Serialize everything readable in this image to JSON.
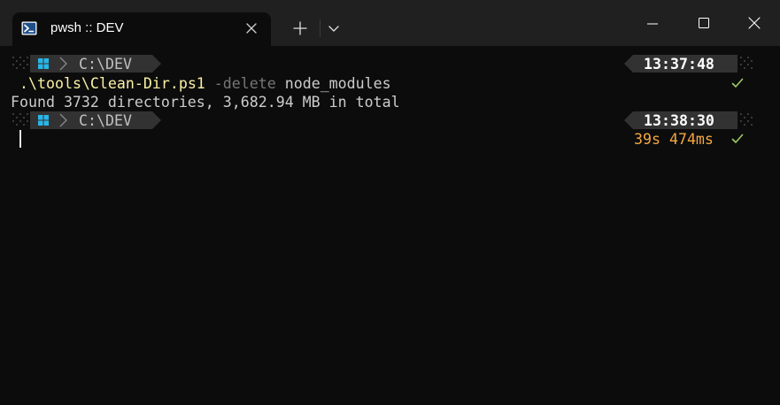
{
  "window": {
    "tab_title": "pwsh :: DEV",
    "tab_icon": "powershell-icon"
  },
  "terminal": {
    "prompt_path": "C:\\DEV",
    "blocks": [
      {
        "time": "13:37:48",
        "command": {
          "exe": ".\\tools\\Clean-Dir.ps1",
          "param": "-delete",
          "arg": "node_modules"
        },
        "status": "success"
      },
      {
        "time": "13:38:30",
        "duration": "39s 474ms",
        "status": "success"
      }
    ],
    "output": "Found 3732 directories, 3,682.94 MB in total"
  },
  "colors": {
    "background": "#0c0c0c",
    "titlebar": "#202020",
    "prompt_segment": "#323232",
    "exe": "#f9f1a5",
    "param": "#767676",
    "duration": "#f5a742",
    "check": "#9ccc65",
    "windows_logo": "#29b6e8"
  }
}
